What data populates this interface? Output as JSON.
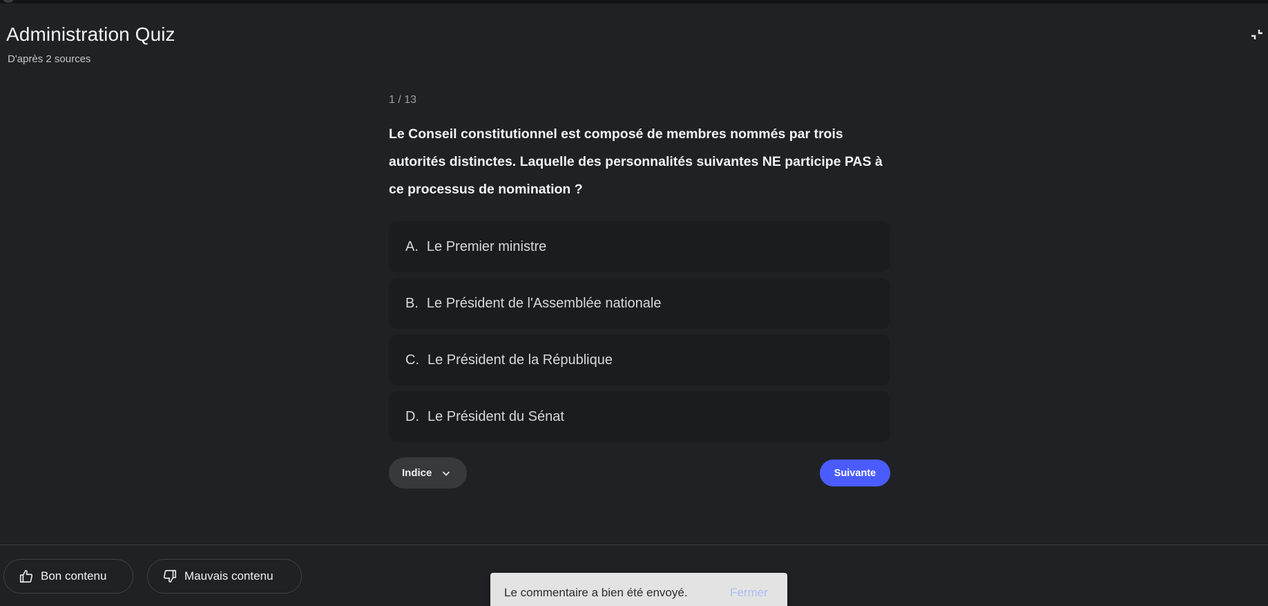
{
  "header": {
    "title": "Administration Quiz",
    "subtitle": "D'après 2 sources"
  },
  "quiz": {
    "counter": "1 / 13",
    "question": "Le Conseil constitutionnel est composé de membres nommés par trois autorités distinctes. Laquelle des personnalités suivantes NE participe PAS à ce processus de nomination ?",
    "options": [
      {
        "letter": "A.",
        "text": "Le Premier ministre"
      },
      {
        "letter": "B.",
        "text": "Le Président de l'Assemblée nationale"
      },
      {
        "letter": "C.",
        "text": "Le Président de la République"
      },
      {
        "letter": "D.",
        "text": "Le Président du Sénat"
      }
    ],
    "hint_label": "Indice",
    "next_label": "Suivante"
  },
  "feedback": {
    "good_label": "Bon contenu",
    "bad_label": "Mauvais contenu"
  },
  "snackbar": {
    "message": "Le commentaire a bien été envoyé.",
    "close_label": "Fermer"
  },
  "colors": {
    "background": "#202124",
    "option_background": "#1b1c1f",
    "primary_button": "#4a5cff",
    "hint_button": "#38393c",
    "snackbar_background": "#e3e3e3",
    "snackbar_action": "#a8c0f5"
  },
  "icons": {
    "collapse": "collapse-icon",
    "hint_chevron": "chevron-down-icon",
    "thumbs_up": "thumbs-up-icon",
    "thumbs_down": "thumbs-down-icon"
  }
}
